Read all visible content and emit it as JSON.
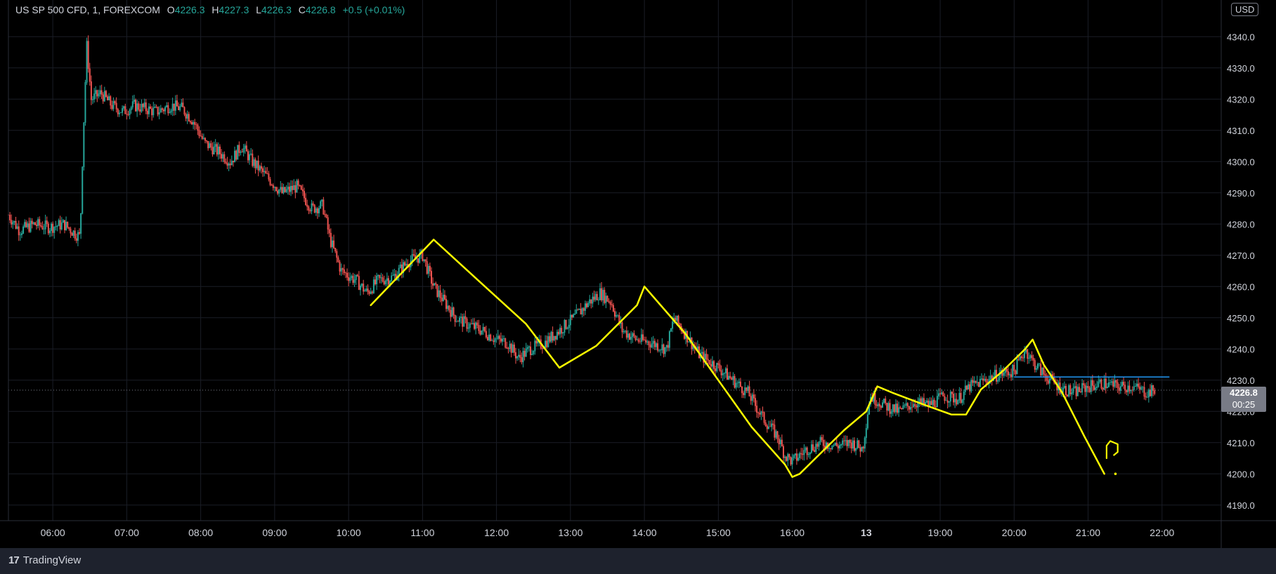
{
  "legend": {
    "symbol": "US SP 500 CFD, 1, FOREXCOM",
    "open_key": "O",
    "open": "4226.3",
    "high_key": "H",
    "high": "4227.3",
    "low_key": "L",
    "low": "4226.3",
    "close_key": "C",
    "close": "4226.8",
    "change": "+0.5 (+0.01%)"
  },
  "currency_badge": "USD",
  "price_tag": {
    "price": "4226.8",
    "countdown": "00:25"
  },
  "footer": {
    "brand": "TradingView",
    "logo_mark": "17"
  },
  "colors": {
    "up": "#26a69a",
    "down": "#ef5350",
    "annotation": "#ffff00",
    "hline": "#2196f3",
    "grid": "#1a1d26"
  },
  "chart_data": {
    "type": "line",
    "title": "US SP 500 CFD, 1, FOREXCOM",
    "xlabel": "",
    "ylabel": "",
    "grid": true,
    "ylim": [
      4185,
      4345
    ],
    "y_ticks": [
      "4190.0",
      "4200.0",
      "4210.0",
      "4220.0",
      "4230.0",
      "4240.0",
      "4250.0",
      "4260.0",
      "4270.0",
      "4280.0",
      "4290.0",
      "4300.0",
      "4310.0",
      "4320.0",
      "4330.0",
      "4340.0"
    ],
    "x_ticks": [
      {
        "label": "06:00",
        "t": 0.6
      },
      {
        "label": "07:00",
        "t": 1.6
      },
      {
        "label": "08:00",
        "t": 2.6
      },
      {
        "label": "09:00",
        "t": 3.6
      },
      {
        "label": "10:00",
        "t": 4.6
      },
      {
        "label": "11:00",
        "t": 5.6
      },
      {
        "label": "12:00",
        "t": 6.6
      },
      {
        "label": "13:00",
        "t": 7.6
      },
      {
        "label": "14:00",
        "t": 8.6
      },
      {
        "label": "15:00",
        "t": 9.6
      },
      {
        "label": "16:00",
        "t": 10.6
      },
      {
        "label": "13",
        "t": 11.6,
        "bold": true
      },
      {
        "label": "19:00",
        "t": 12.6
      },
      {
        "label": "20:00",
        "t": 13.6
      },
      {
        "label": "21:00",
        "t": 14.6
      },
      {
        "label": "22:00",
        "t": 15.6
      }
    ],
    "xlim": [
      0,
      16.4
    ],
    "series": [
      {
        "values": [
          [
            0.0,
            4283
          ],
          [
            0.15,
            4278
          ],
          [
            0.35,
            4280
          ],
          [
            0.55,
            4279
          ],
          [
            0.75,
            4280
          ],
          [
            0.9,
            4277
          ],
          [
            0.97,
            4276
          ],
          [
            1.0,
            4300
          ],
          [
            1.03,
            4320
          ],
          [
            1.06,
            4337
          ],
          [
            1.12,
            4320
          ],
          [
            1.25,
            4322
          ],
          [
            1.4,
            4318
          ],
          [
            1.55,
            4316
          ],
          [
            1.7,
            4318
          ],
          [
            1.85,
            4317
          ],
          [
            2.0,
            4316
          ],
          [
            2.2,
            4318
          ],
          [
            2.35,
            4317
          ],
          [
            2.5,
            4313
          ],
          [
            2.65,
            4306
          ],
          [
            2.85,
            4303
          ],
          [
            3.0,
            4300
          ],
          [
            3.15,
            4305
          ],
          [
            3.3,
            4300
          ],
          [
            3.5,
            4295
          ],
          [
            3.7,
            4290
          ],
          [
            3.9,
            4292
          ],
          [
            4.1,
            4285
          ],
          [
            4.25,
            4286
          ],
          [
            4.35,
            4275
          ],
          [
            4.5,
            4265
          ],
          [
            4.7,
            4262
          ],
          [
            4.85,
            4258
          ],
          [
            5.0,
            4262
          ],
          [
            5.2,
            4263
          ],
          [
            5.4,
            4268
          ],
          [
            5.6,
            4270
          ],
          [
            5.75,
            4260
          ],
          [
            5.9,
            4255
          ],
          [
            6.05,
            4250
          ],
          [
            6.2,
            4248
          ],
          [
            6.4,
            4246
          ],
          [
            6.6,
            4243
          ],
          [
            6.75,
            4242
          ],
          [
            6.9,
            4237
          ],
          [
            7.05,
            4240
          ],
          [
            7.25,
            4242
          ],
          [
            7.45,
            4246
          ],
          [
            7.65,
            4250
          ],
          [
            7.85,
            4255
          ],
          [
            8.0,
            4258
          ],
          [
            8.15,
            4255
          ],
          [
            8.3,
            4246
          ],
          [
            8.5,
            4243
          ],
          [
            8.7,
            4242
          ],
          [
            8.9,
            4240
          ],
          [
            9.0,
            4250
          ],
          [
            9.15,
            4245
          ],
          [
            9.35,
            4238
          ],
          [
            9.55,
            4235
          ],
          [
            9.8,
            4230
          ],
          [
            10.0,
            4226
          ],
          [
            10.2,
            4218
          ],
          [
            10.4,
            4212
          ],
          [
            10.5,
            4206
          ],
          [
            10.6,
            4204
          ],
          [
            10.8,
            4208
          ],
          [
            11.0,
            4210
          ],
          [
            11.2,
            4209
          ],
          [
            11.4,
            4210
          ],
          [
            11.55,
            4208
          ],
          [
            11.65,
            4225
          ],
          [
            11.85,
            4222
          ],
          [
            12.05,
            4220
          ],
          [
            12.25,
            4223
          ],
          [
            12.45,
            4222
          ],
          [
            12.65,
            4225
          ],
          [
            12.85,
            4224
          ],
          [
            13.0,
            4228
          ],
          [
            13.2,
            4230
          ],
          [
            13.4,
            4232
          ],
          [
            13.6,
            4233
          ],
          [
            13.75,
            4240
          ],
          [
            13.85,
            4236
          ],
          [
            14.0,
            4232
          ],
          [
            14.2,
            4228
          ],
          [
            14.4,
            4226
          ],
          [
            14.6,
            4228
          ],
          [
            14.8,
            4229
          ],
          [
            15.0,
            4228
          ],
          [
            15.2,
            4228
          ],
          [
            15.4,
            4226
          ],
          [
            15.5,
            4226.8
          ]
        ]
      }
    ],
    "annotations": {
      "zigzag": [
        [
          4.9,
          4254
        ],
        [
          5.75,
          4275
        ],
        [
          6.35,
          4262
        ],
        [
          7.0,
          4248
        ],
        [
          7.45,
          4234
        ],
        [
          7.95,
          4241
        ],
        [
          8.5,
          4254
        ],
        [
          8.6,
          4260
        ],
        [
          9.15,
          4245
        ],
        [
          9.6,
          4230
        ],
        [
          10.05,
          4215
        ],
        [
          10.5,
          4203
        ],
        [
          10.6,
          4199
        ],
        [
          10.7,
          4200
        ],
        [
          11.0,
          4207
        ],
        [
          11.3,
          4214
        ],
        [
          11.6,
          4220
        ],
        [
          11.75,
          4228
        ],
        [
          11.95,
          4226
        ],
        [
          12.4,
          4222
        ],
        [
          12.75,
          4219
        ],
        [
          12.95,
          4219
        ],
        [
          13.15,
          4227
        ],
        [
          13.45,
          4233
        ],
        [
          13.75,
          4240
        ],
        [
          13.85,
          4243
        ],
        [
          14.0,
          4235
        ],
        [
          14.25,
          4226
        ],
        [
          14.55,
          4212
        ],
        [
          14.82,
          4200
        ]
      ],
      "question_mark": [
        [
          14.85,
          4205
        ],
        [
          14.85,
          4209
        ],
        [
          14.9,
          4210.5
        ],
        [
          15.0,
          4209.5
        ],
        [
          15.0,
          4207
        ],
        [
          14.95,
          4206
        ]
      ],
      "question_dot": [
        14.97,
        4200
      ],
      "hline": {
        "t_start": 13.6,
        "t_end": 15.7,
        "y": 4231
      },
      "last_price_y": 4226.8
    }
  }
}
